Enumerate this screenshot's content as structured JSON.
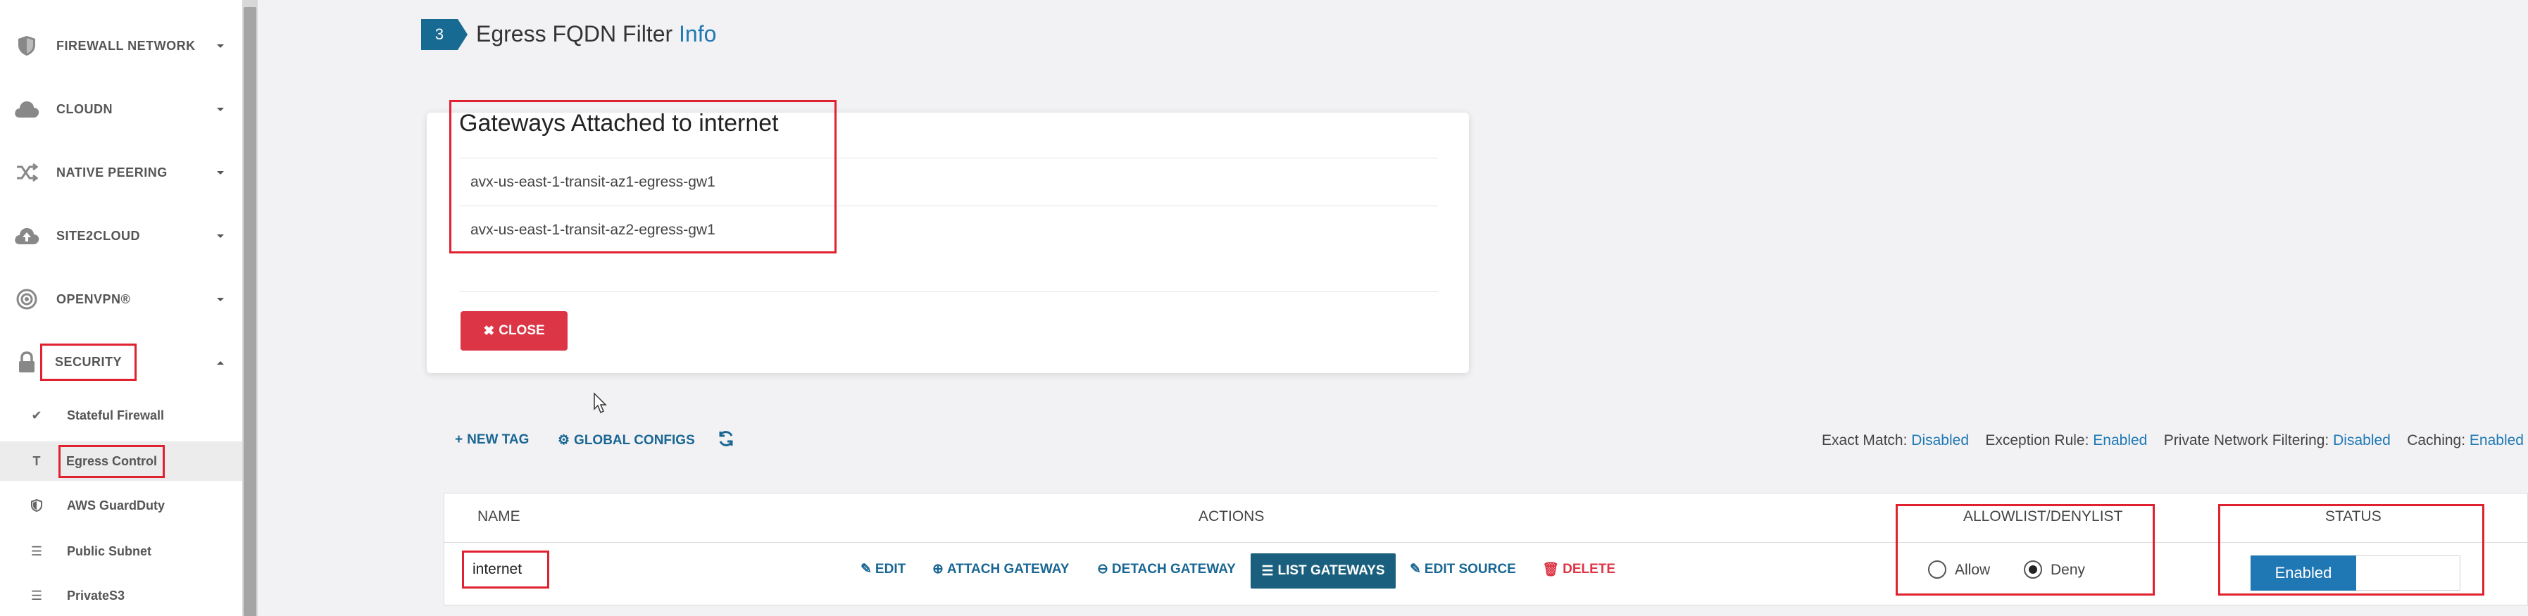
{
  "sidebar": {
    "items": [
      {
        "label": "FIREWALL NETWORK",
        "icon": "shield-icon"
      },
      {
        "label": "CLOUDN",
        "icon": "cloud-icon"
      },
      {
        "label": "NATIVE PEERING",
        "icon": "shuffle-icon"
      },
      {
        "label": "SITE2CLOUD",
        "icon": "cloud-upload-icon"
      },
      {
        "label": "OPENVPN®",
        "icon": "target-icon"
      },
      {
        "label": "SECURITY",
        "icon": "lock-icon"
      }
    ],
    "security_sub": [
      {
        "label": "Stateful Firewall",
        "icon": "check-icon"
      },
      {
        "label": "Egress Control",
        "icon": "text-t-icon"
      },
      {
        "label": "AWS GuardDuty",
        "icon": "shield-half-icon"
      },
      {
        "label": "Public Subnet",
        "icon": "list-icon"
      },
      {
        "label": "PrivateS3",
        "icon": "list-icon"
      }
    ]
  },
  "step": {
    "number": "3",
    "title": "Egress FQDN Filter",
    "info": "Info"
  },
  "gateways_popup": {
    "title": "Gateways Attached to internet",
    "gateways": [
      "avx-us-east-1-transit-az1-egress-gw1",
      "avx-us-east-1-transit-az2-egress-gw1"
    ],
    "close_label": "CLOSE"
  },
  "toolbar": {
    "new_tag": "NEW TAG",
    "global_configs": "GLOBAL CONFIGS",
    "exact_match_label": "Exact Match:",
    "exact_match_value": "Disabled",
    "exception_rule_label": "Exception Rule:",
    "exception_rule_value": "Enabled",
    "private_filtering_label": "Private Network Filtering:",
    "private_filtering_value": "Disabled",
    "caching_label": "Caching:",
    "caching_value": "Enabled"
  },
  "table": {
    "headers": {
      "name": "NAME",
      "actions": "ACTIONS",
      "allowlist": "ALLOWLIST/DENYLIST",
      "status": "STATUS"
    },
    "row": {
      "name": "internet",
      "actions": {
        "edit": "EDIT",
        "attach": "ATTACH GATEWAY",
        "detach": "DETACH GATEWAY",
        "list": "LIST GATEWAYS",
        "edit_source": "EDIT SOURCE",
        "delete": "DELETE"
      },
      "allow_label": "Allow",
      "deny_label": "Deny",
      "selected": "Deny",
      "status": "Enabled"
    }
  },
  "colors": {
    "accent": "#1f78b4",
    "danger": "#dc3545",
    "highlight": "#e0212f",
    "dark_button": "#1a5f7d"
  }
}
